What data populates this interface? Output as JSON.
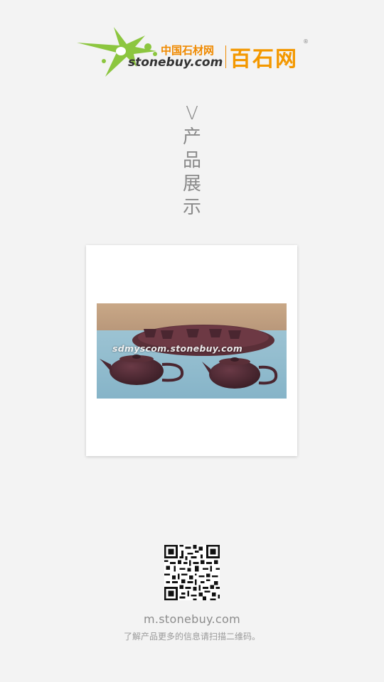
{
  "logo": {
    "cn_small": "中国石材网",
    "domain": "stonebuy.com",
    "brand_cn": "百石网",
    "registered_mark": "®",
    "star_color": "#8cc63f",
    "orange_color": "#f39800"
  },
  "section": {
    "glyphs": [
      "V",
      "产",
      "品",
      "展",
      "示"
    ]
  },
  "product": {
    "watermark": "sdmyscom.stonebuy.com",
    "image_subject": "purple clay teapot tea set"
  },
  "footer": {
    "qr_icon": "qr-code-icon",
    "url": "m.stonebuy.com",
    "tip": "了解产品更多的信息请扫描二维码。"
  }
}
